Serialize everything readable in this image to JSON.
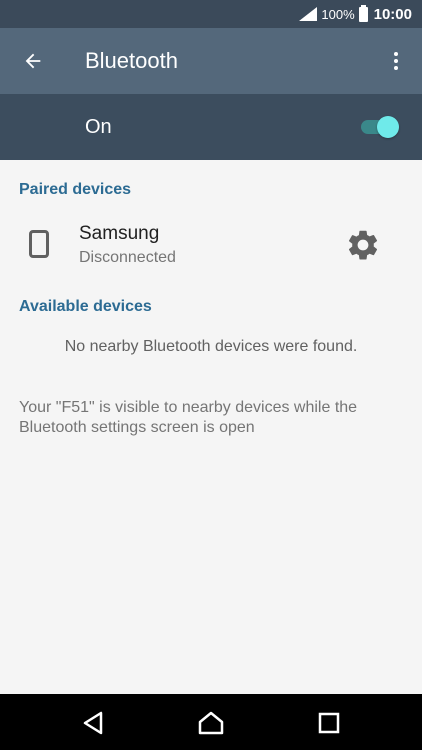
{
  "status_bar": {
    "battery_percent": "100%",
    "time": "10:00",
    "icons": [
      "signal-icon",
      "battery-icon"
    ]
  },
  "app_bar": {
    "title": "Bluetooth",
    "icons": [
      "back-arrow-icon",
      "more-vert-icon"
    ]
  },
  "master_switch": {
    "label": "On",
    "state": true,
    "accent": "#6feaea"
  },
  "paired": {
    "header": "Paired devices",
    "devices": [
      {
        "name": "Samsung",
        "status": "Disconnected",
        "icon": "phone-icon",
        "action_icon": "gear-icon"
      }
    ]
  },
  "available": {
    "header": "Available devices",
    "empty_message": "No nearby Bluetooth devices were found."
  },
  "visibility_note": "Your \"F51\" is visible to nearby devices while the Bluetooth settings screen is open",
  "nav_bar": {
    "icons": [
      "back-triangle-icon",
      "home-icon",
      "recents-icon"
    ]
  },
  "colors": {
    "status_bar": "#3b4a5a",
    "app_bar": "#54687b",
    "switch_bar": "#3c4d5e",
    "section_header": "#2c6b93",
    "background": "#f5f5f5"
  }
}
